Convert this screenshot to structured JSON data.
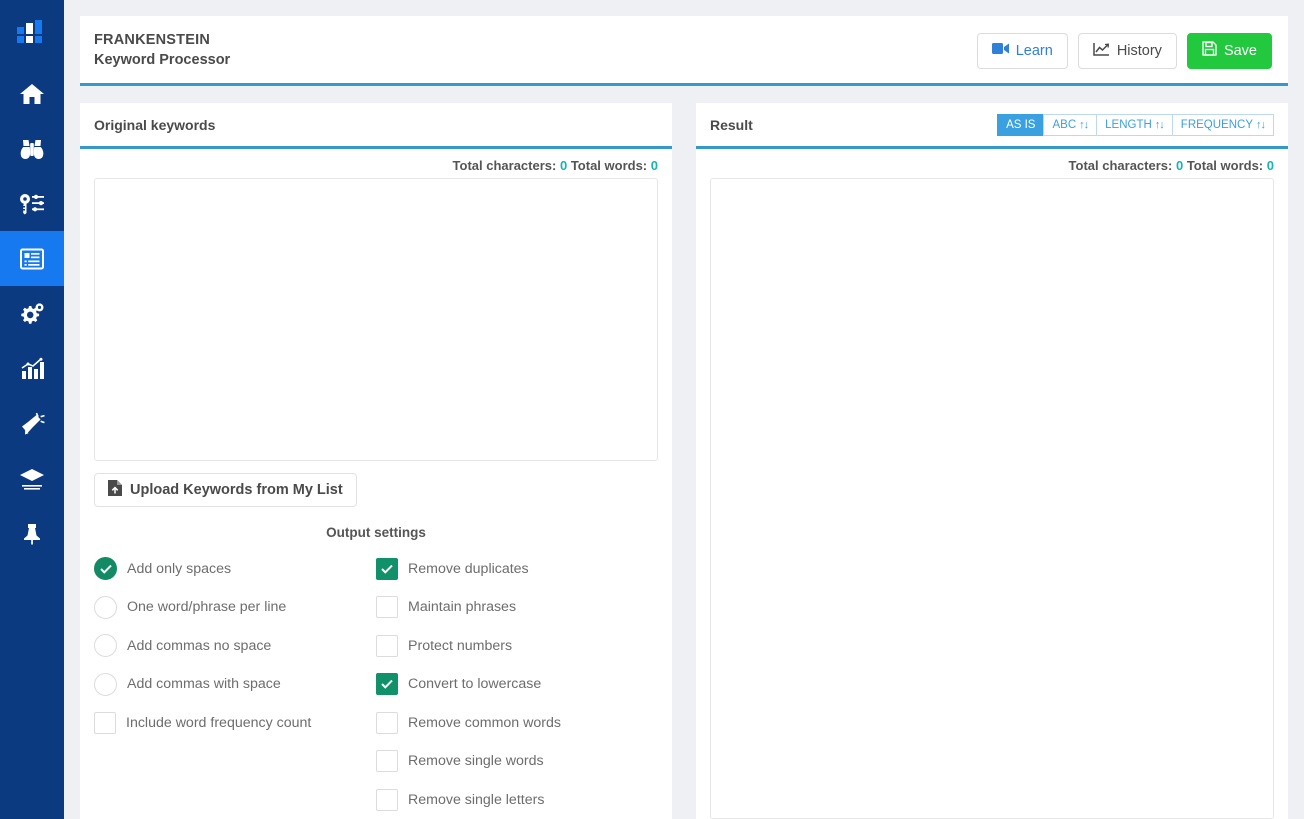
{
  "sidebar": {
    "logo_icon": "bar-chart-logo-icon",
    "items": [
      {
        "icon": "home-icon",
        "name": "home",
        "active": false
      },
      {
        "icon": "binoculars-icon",
        "name": "research",
        "active": false
      },
      {
        "icon": "key-settings-icon",
        "name": "keywords",
        "active": false
      },
      {
        "icon": "document-list-icon",
        "name": "keyword-processor",
        "active": true
      },
      {
        "icon": "gears-icon",
        "name": "tools",
        "active": false
      },
      {
        "icon": "chart-bars-icon",
        "name": "analytics",
        "active": false
      },
      {
        "icon": "megaphone-icon",
        "name": "promotion",
        "active": false
      },
      {
        "icon": "graduation-cap-icon",
        "name": "learning",
        "active": false
      },
      {
        "icon": "pushpin-icon",
        "name": "pinned",
        "active": false
      }
    ]
  },
  "header": {
    "title": "FRANKENSTEIN",
    "subtitle": "Keyword Processor",
    "learn_label": "Learn",
    "history_label": "History",
    "save_label": "Save",
    "learn_icon": "video-camera-icon",
    "history_icon": "chart-line-icon",
    "save_icon": "floppy-disk-icon"
  },
  "original_panel": {
    "title": "Original keywords",
    "total_characters_label": "Total characters:",
    "total_characters_value": "0",
    "total_words_label": "Total words:",
    "total_words_value": "0",
    "textarea_value": "",
    "textarea_placeholder": "",
    "upload_label": "Upload Keywords from My List",
    "upload_icon": "file-upload-icon"
  },
  "result_panel": {
    "title": "Result",
    "total_characters_label": "Total characters:",
    "total_characters_value": "0",
    "total_words_label": "Total words:",
    "total_words_value": "0",
    "textarea_value": "",
    "textarea_placeholder": "",
    "sort_buttons": [
      {
        "label": "AS IS",
        "arrows": "",
        "active": true
      },
      {
        "label": "ABC",
        "arrows": "↑↓",
        "active": false
      },
      {
        "label": "LENGTH",
        "arrows": "↑↓",
        "active": false
      },
      {
        "label": "FREQUENCY",
        "arrows": "↑↓",
        "active": false
      }
    ]
  },
  "output_settings": {
    "title": "Output settings",
    "left_options": [
      {
        "label": "Add only spaces",
        "type": "radio",
        "checked": true
      },
      {
        "label": "One word/phrase per line",
        "type": "radio",
        "checked": false
      },
      {
        "label": "Add commas no space",
        "type": "radio",
        "checked": false
      },
      {
        "label": "Add commas with space",
        "type": "radio",
        "checked": false
      },
      {
        "label": "Include word frequency count",
        "type": "checkbox",
        "checked": false
      }
    ],
    "right_options": [
      {
        "label": "Remove duplicates",
        "type": "checkbox",
        "checked": true
      },
      {
        "label": "Maintain phrases",
        "type": "checkbox",
        "checked": false
      },
      {
        "label": "Protect numbers",
        "type": "checkbox",
        "checked": false
      },
      {
        "label": "Convert to lowercase",
        "type": "checkbox",
        "checked": true
      },
      {
        "label": "Remove common words",
        "type": "checkbox",
        "checked": false
      },
      {
        "label": "Remove single words",
        "type": "checkbox",
        "checked": false
      },
      {
        "label": "Remove single letters",
        "type": "checkbox",
        "checked": false
      }
    ]
  },
  "colors": {
    "sidebar_bg": "#0b3a80",
    "sidebar_active": "#1779f0",
    "accent_blue": "#3498c8",
    "save_green": "#22c93f",
    "check_teal": "#10916a",
    "count_teal": "#19b3b3",
    "page_bg": "#eef0f4"
  }
}
